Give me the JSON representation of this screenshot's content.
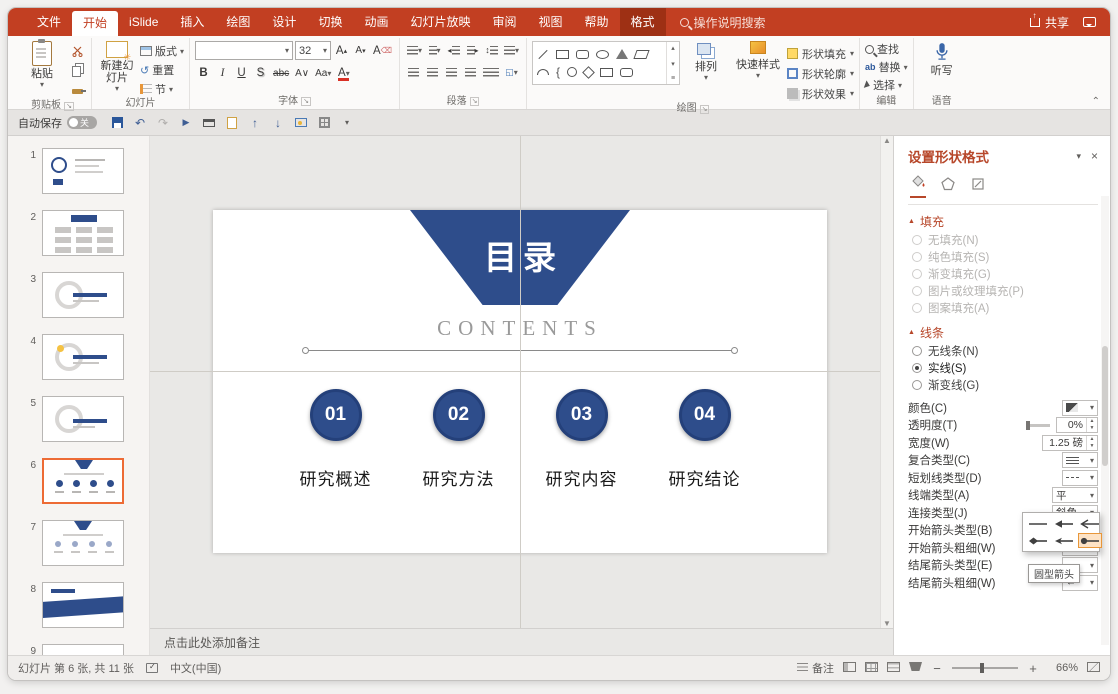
{
  "menubar": {
    "tabs": [
      {
        "label": "文件",
        "style": "normal"
      },
      {
        "label": "开始",
        "style": "active"
      },
      {
        "label": "iSlide",
        "style": "normal"
      },
      {
        "label": "插入",
        "style": "normal"
      },
      {
        "label": "绘图",
        "style": "normal"
      },
      {
        "label": "设计",
        "style": "normal"
      },
      {
        "label": "切换",
        "style": "normal"
      },
      {
        "label": "动画",
        "style": "normal"
      },
      {
        "label": "幻灯片放映",
        "style": "normal"
      },
      {
        "label": "审阅",
        "style": "normal"
      },
      {
        "label": "视图",
        "style": "normal"
      },
      {
        "label": "帮助",
        "style": "normal"
      },
      {
        "label": "格式",
        "style": "contextual"
      }
    ],
    "search_label": "操作说明搜索",
    "share_label": "共享"
  },
  "quickbar": {
    "autosave_label": "自动保存",
    "autosave_state": "关",
    "icons": [
      "save-icon",
      "undo-icon",
      "redo-icon",
      "slideshow-icon",
      "print-icon",
      "new-slide-icon",
      "move-up-icon",
      "move-down-icon",
      "image-icon",
      "grid-icon",
      "customize-quickbar-icon"
    ]
  },
  "ribbon": {
    "groups": {
      "clipboard": {
        "label": "剪贴板",
        "paste": "粘贴"
      },
      "slides": {
        "label": "幻灯片",
        "new_slide": "新建幻灯片",
        "layout": "版式",
        "reset": "重置",
        "section": "节"
      },
      "font": {
        "label": "字体",
        "size": "32"
      },
      "paragraph": {
        "label": "段落"
      },
      "drawing": {
        "label": "绘图",
        "arrange": "排列",
        "quick_styles": "快速样式",
        "shape_fill": "形状填充",
        "shape_outline": "形状轮廓",
        "shape_effects": "形状效果"
      },
      "editing": {
        "label": "编辑",
        "find": "查找",
        "replace": "替换",
        "select": "选择"
      },
      "voice": {
        "label": "语音",
        "dictate": "听写"
      }
    }
  },
  "thumbnails": {
    "selected": 6,
    "items": [
      {
        "n": "1",
        "variant": "diagram"
      },
      {
        "n": "2",
        "variant": "grid"
      },
      {
        "n": "3",
        "variant": "ring"
      },
      {
        "n": "4",
        "variant": "ring-highlight"
      },
      {
        "n": "5",
        "variant": "ring2"
      },
      {
        "n": "6",
        "variant": "toc"
      },
      {
        "n": "7",
        "variant": "toc2"
      },
      {
        "n": "8",
        "variant": "band"
      },
      {
        "n": "9",
        "variant": "blank"
      }
    ]
  },
  "slide": {
    "title": "目录",
    "subtitle": "CONTENTS",
    "items": [
      {
        "num": "01",
        "label": "研究概述"
      },
      {
        "num": "02",
        "label": "研究方法"
      },
      {
        "num": "03",
        "label": "研究内容"
      },
      {
        "num": "04",
        "label": "研究结论"
      }
    ]
  },
  "notes": {
    "placeholder": "点击此处添加备注"
  },
  "format_panel": {
    "title": "设置形状格式",
    "fill_section": "填充",
    "line_section": "线条",
    "fill_options": [
      "无填充(N)",
      "纯色填充(S)",
      "渐变填充(G)",
      "图片或纹理填充(P)",
      "图案填充(A)"
    ],
    "line_options": [
      {
        "label": "无线条(N)",
        "selected": false
      },
      {
        "label": "实线(S)",
        "selected": true
      },
      {
        "label": "渐变线(G)",
        "selected": false
      }
    ],
    "properties": [
      {
        "label": "颜色(C)",
        "control": "color"
      },
      {
        "label": "透明度(T)",
        "control": "slider",
        "value": "0%"
      },
      {
        "label": "宽度(W)",
        "control": "spin",
        "value": "1.25 磅"
      },
      {
        "label": "复合类型(C)",
        "control": "dropdown",
        "icon": "compound-type-icon"
      },
      {
        "label": "短划线类型(D)",
        "control": "dropdown",
        "icon": "dash-type-icon"
      },
      {
        "label": "线端类型(A)",
        "control": "dropdown-text",
        "value": "平"
      },
      {
        "label": "连接类型(J)",
        "control": "dropdown-text",
        "value": "斜角"
      },
      {
        "label": "开始箭头类型(B)",
        "control": "dropdown",
        "icon": "begin-arrow-icon",
        "open": true
      },
      {
        "label": "开始箭头粗细(W)",
        "control": "dropdown",
        "icon": "arrow-size-icon"
      },
      {
        "label": "结尾箭头类型(E)",
        "control": "dropdown",
        "icon": "end-arrow-icon"
      },
      {
        "label": "结尾箭头粗细(W)",
        "control": "dropdown",
        "icon": "arrow-size-icon"
      }
    ],
    "arrow_gallery": {
      "cells": [
        {
          "name": "no-arrow",
          "selected": false
        },
        {
          "name": "triangle-arrow",
          "selected": false
        },
        {
          "name": "open-arrow",
          "selected": false
        },
        {
          "name": "diamond-arrow",
          "selected": false
        },
        {
          "name": "stealth-arrow",
          "selected": false
        },
        {
          "name": "round-arrow",
          "selected": true
        }
      ],
      "tooltip": "圆型箭头"
    }
  },
  "statusbar": {
    "slide_info": "幻灯片 第 6 张, 共 11 张",
    "language": "中文(中国)",
    "notes_label": "备注",
    "zoom_level": "66%"
  }
}
